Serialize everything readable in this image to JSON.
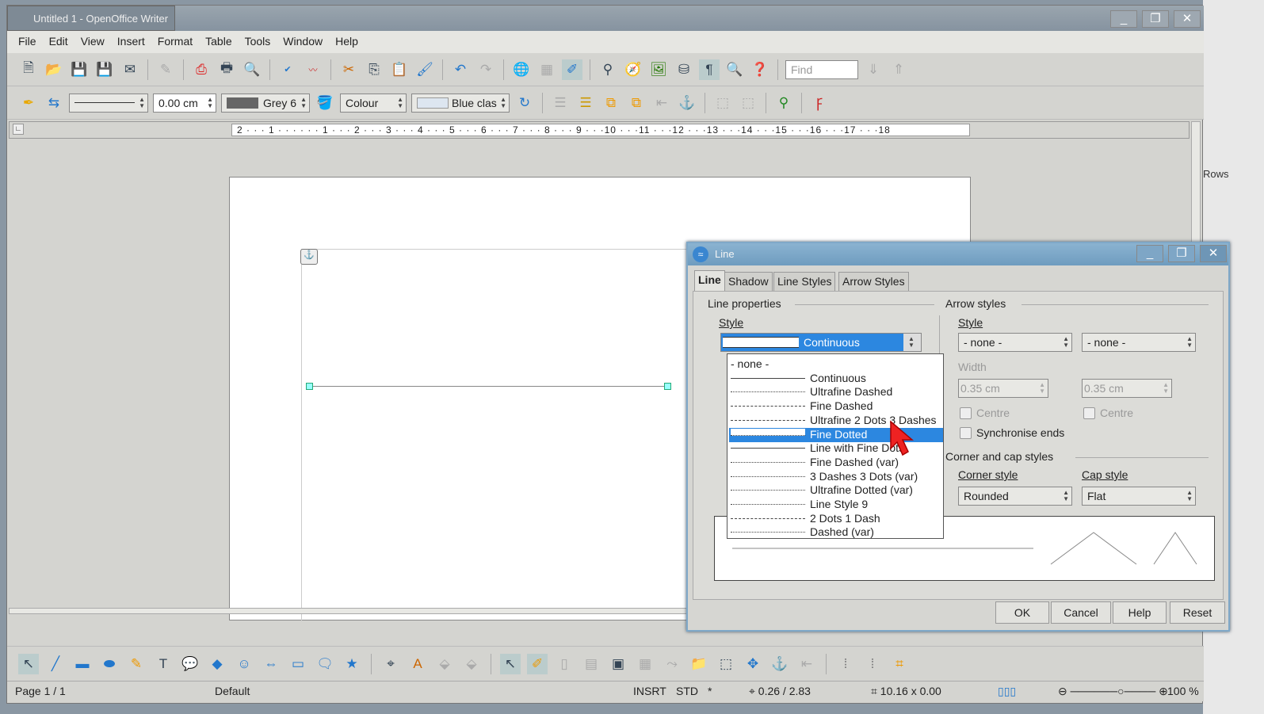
{
  "window": {
    "title": "Untitled 1 - OpenOffice Writer"
  },
  "menu": [
    "File",
    "Edit",
    "View",
    "Insert",
    "Format",
    "Table",
    "Tools",
    "Window",
    "Help"
  ],
  "toolbar": {
    "find_placeholder": "Find"
  },
  "drawing_props": {
    "line_width": "0.00 cm",
    "line_color": "Grey 6",
    "area_style": "Colour",
    "area_color": "Blue clas"
  },
  "ruler": {
    "text": "2 · · · 1 · · · · · · 1 · · · 2 · · · 3 · · · 4 · · · 5 · · · 6 · · · 7 · · · 8 · · · 9 · · ·10 · · ·11 · · ·12 · · ·13 · · ·14 · · ·15 · · ·16 · · ·17 · · ·18"
  },
  "background": {
    "rows_label": "Rows"
  },
  "status": {
    "page": "Page 1 / 1",
    "style": "Default",
    "mode": "INSRT",
    "sel": "STD",
    "modified": "*",
    "position": "0.26 / 2.83",
    "size": "10.16 x 0.00",
    "zoom": "100 %"
  },
  "dialog": {
    "title": "Line",
    "tabs": [
      "Line",
      "Shadow",
      "Line Styles",
      "Arrow Styles"
    ],
    "line_properties": "Line properties",
    "style_label": "Style",
    "style_value": "Continuous",
    "style_options": [
      {
        "label": "- none -",
        "dash": "none"
      },
      {
        "label": "Continuous",
        "dash": "solid"
      },
      {
        "label": "Ultrafine Dashed",
        "dash": "dotted"
      },
      {
        "label": "Fine Dashed",
        "dash": "dashed"
      },
      {
        "label": "Ultrafine 2 Dots 3 Dashes",
        "dash": "dashed"
      },
      {
        "label": "Fine Dotted",
        "dash": "dotted",
        "selected": true
      },
      {
        "label": "Line with Fine Dots",
        "dash": "solid"
      },
      {
        "label": "Fine Dashed (var)",
        "dash": "dotted"
      },
      {
        "label": "3 Dashes 3 Dots (var)",
        "dash": "dotted"
      },
      {
        "label": "Ultrafine Dotted (var)",
        "dash": "dotted"
      },
      {
        "label": "Line Style 9",
        "dash": "dotted"
      },
      {
        "label": "2 Dots 1 Dash",
        "dash": "dashed"
      },
      {
        "label": "Dashed (var)",
        "dash": "dotted"
      }
    ],
    "arrow_styles": "Arrow styles",
    "arrow_style_label": "Style",
    "arrow_start": "- none -",
    "arrow_end": "- none -",
    "width_label": "Width",
    "width_start": "0.35 cm",
    "width_end": "0.35 cm",
    "centre_label": "Centre",
    "sync_label": "Synchronise ends",
    "corner_cap": "Corner and cap styles",
    "corner_label": "Corner style",
    "corner_value": "Rounded",
    "cap_label": "Cap style",
    "cap_value": "Flat",
    "buttons": {
      "ok": "OK",
      "cancel": "Cancel",
      "help": "Help",
      "reset": "Reset"
    }
  },
  "colors": {
    "selection": "#2c87e0",
    "dialog_title": "#7aa6c8"
  }
}
